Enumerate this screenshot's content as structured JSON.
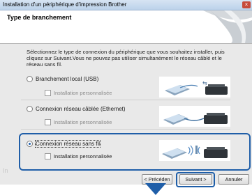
{
  "window": {
    "title": "Installation d'un périphérique d'impression Brother",
    "close_glyph": "×"
  },
  "header": {
    "title": "Type de branchement"
  },
  "intro": "Sélectionnez le type de connexion du périphérique que vous souhaitez installer, puis cliquez sur Suivant.Vous ne pouvez pas utiliser simultanément le réseau câblé et le réseau sans fil.",
  "options": [
    {
      "label": "Branchement local (USB)",
      "selected": false,
      "sub_label": "Installation personnalisée",
      "sub_enabled": false
    },
    {
      "label": "Connexion réseau câblée (Ethernet)",
      "selected": false,
      "sub_label": "Installation personnalisée",
      "sub_enabled": false
    },
    {
      "label": "Connexion réseau sans fil",
      "selected": true,
      "sub_label": "Installation personnalisée",
      "sub_enabled": true
    }
  ],
  "ghost_text": "In",
  "buttons": {
    "prev": "< Précéden",
    "next": "Suivant >",
    "cancel": "Annuler"
  },
  "colors": {
    "highlight": "#1f5ea8",
    "arrow": "#1f5ea8",
    "window_bg": "#e9e9e9"
  }
}
